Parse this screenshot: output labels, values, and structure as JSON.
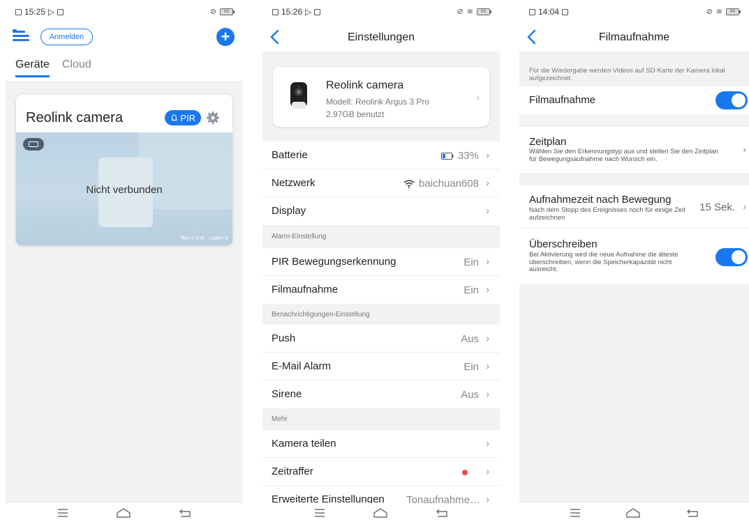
{
  "screen1": {
    "status_time": "15:25",
    "battery_level": "83",
    "login_label": "Anmelden",
    "add_symbol": "+",
    "tabs": [
      "Geräte",
      "Cloud"
    ],
    "active_tab": "Geräte",
    "camera_card": {
      "name": "Reolink camera",
      "pir_label": "PIR",
      "status_text": "Nicht verbunden",
      "watermark": "Reolink camera"
    }
  },
  "screen2": {
    "status_time": "15:26",
    "battery_level": "83",
    "title": "Einstellungen",
    "device": {
      "name": "Reolink camera",
      "model": "Modell: Reolink Argus 3 Pro",
      "storage_used": "2.97GB benutzt"
    },
    "rows_main": [
      {
        "label": "Batterie",
        "value": "33%"
      },
      {
        "label": "Netzwerk",
        "value": "baichuan608"
      },
      {
        "label": "Display",
        "value": ""
      }
    ],
    "section_alarm": "Alarm-Einstellung",
    "rows_alarm": [
      {
        "label": "PIR Bewegungserkennung",
        "value": "Ein"
      },
      {
        "label": "Filmaufnahme",
        "value": "Ein"
      }
    ],
    "section_notify": "Benachrichtigungen-Einstellung",
    "rows_notify": [
      {
        "label": "Push",
        "value": "Aus"
      },
      {
        "label": "E-Mail Alarm",
        "value": "Ein"
      },
      {
        "label": "Sirene",
        "value": "Aus"
      }
    ],
    "section_more": "Mehr",
    "rows_more": [
      {
        "label": "Kamera teilen",
        "value": ""
      },
      {
        "label": "Zeitraffer",
        "value": ""
      },
      {
        "label": "Erweiterte Einstellungen",
        "value": "Tonaufnahme…"
      }
    ]
  },
  "screen3": {
    "status_time": "14:04",
    "battery_level": "84",
    "title": "Filmaufnahme",
    "note": "Für die Wiedergabe werden Videos auf SD-Karte der Kamera lokal aufgezeichnet.",
    "recording": {
      "label": "Filmaufnahme",
      "enabled": true
    },
    "schedule": {
      "label": "Zeitplan",
      "description": "Wählen Sie den Erkennungstyp aus und stellen Sie den Zeitplan für Bewegungsaufnahme nach Wunsch ein."
    },
    "post_motion": {
      "label": "Aufnahmezeit nach Bewegung",
      "description": "Nach dem Stopp des Ereignisses noch für einige Zeit aufzeichnen",
      "value": "15 Sek."
    },
    "overwrite": {
      "label": "Überschreiben",
      "description": "Bei Aktivierung wird die neue Aufnahme die älteste überschreiben, wenn die Speicherkapazität nicht ausreicht.",
      "enabled": true
    }
  },
  "colors": {
    "accent": "#1a78ef",
    "background": "#f2f2f2",
    "alert": "#f04a4a"
  },
  "icons": [
    "menu-icon",
    "plus-icon",
    "bell-icon",
    "gear-icon",
    "back-icon",
    "battery-icon",
    "wifi-icon",
    "chevron-right-icon",
    "home-icon",
    "recent-apps-icon",
    "return-icon"
  ]
}
